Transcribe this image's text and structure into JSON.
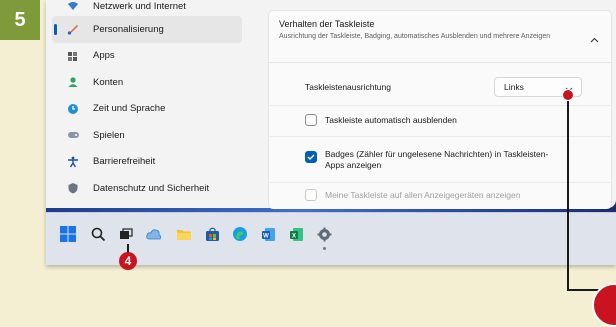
{
  "step_number": "5",
  "callout_number": "4",
  "nav": {
    "items": [
      {
        "label": "Netzwerk und Internet",
        "icon": "wifi-icon"
      },
      {
        "label": "Personalisierung",
        "icon": "brush-icon"
      },
      {
        "label": "Apps",
        "icon": "apps-icon"
      },
      {
        "label": "Konten",
        "icon": "person-icon"
      },
      {
        "label": "Zeit und Sprache",
        "icon": "globe-clock-icon"
      },
      {
        "label": "Spielen",
        "icon": "gamepad-icon"
      },
      {
        "label": "Barrierefreiheit",
        "icon": "accessibility-icon"
      },
      {
        "label": "Datenschutz und Sicherheit",
        "icon": "shield-icon"
      }
    ]
  },
  "section": {
    "title": "Verhalten der Taskleiste",
    "subtitle": "Ausrichtung der Taskleiste, Badging, automatisches Ausblenden und mehrere Anzeigen"
  },
  "settings": {
    "alignment_label": "Taskleistenausrichtung",
    "alignment_value": "Links",
    "autohide_label": "Taskleiste automatisch ausblenden",
    "autohide_checked": false,
    "badges_label_1": "Badges (Zähler für ungelesene Nachrichten) in Taskleisten-",
    "badges_label_2": "Apps anzeigen",
    "badges_checked": true,
    "multi_display_label": "Meine Taskleiste auf allen Anzeigegeräten anzeigen",
    "multi_display_checked": false,
    "multi_display_disabled": true
  },
  "taskbar": {
    "icons": [
      "windows-start-icon",
      "search-icon",
      "task-view-icon",
      "weather-icon",
      "file-explorer-icon",
      "store-icon",
      "edge-icon",
      "word-icon",
      "excel-icon",
      "settings-icon"
    ]
  },
  "colors": {
    "accent": "#005fb8",
    "callout_red": "#c9141f",
    "step_badge_green": "#7f9a3a",
    "page_background": "#f4efd3"
  }
}
